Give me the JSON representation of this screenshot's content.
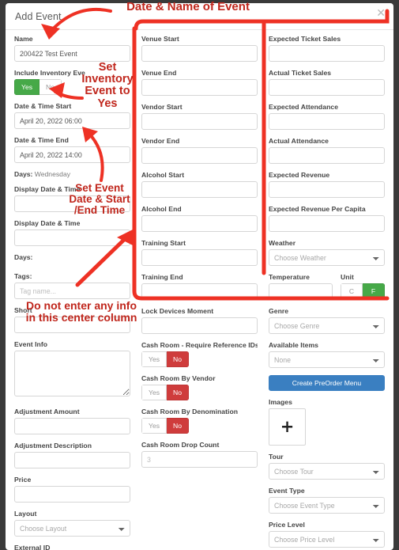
{
  "window": {
    "title": "Add Event",
    "close_icon": "close-icon",
    "close_glyph": "✕"
  },
  "colors": {
    "toggle_on_green": "#46a948",
    "toggle_on_red": "#cf3c3c",
    "primary_button": "#3a7fc1",
    "annotation_red": "#c0261c",
    "label_text": "#444444",
    "input_border": "#d6d6d6"
  },
  "left_column": {
    "name": {
      "label": "Name",
      "value": "200422 Test Event",
      "placeholder": ""
    },
    "include_inventory": {
      "label": "Include Inventory Eve",
      "options": [
        "Yes",
        "No"
      ],
      "selected": "Yes"
    },
    "datetime_start": {
      "label": "Date & Time Start",
      "value": "April 20, 2022 06:00"
    },
    "datetime_end": {
      "label": "Date & Time End",
      "value": "April 20, 2022 14:00"
    },
    "days_1": {
      "label": "Days:",
      "value": "Wednesday"
    },
    "display_datetime_1": {
      "label": "Display Date & Time",
      "value": ""
    },
    "display_datetime_2": {
      "label": "Display Date & Time",
      "value": ""
    },
    "days_2": {
      "label": "Days:",
      "value": ""
    },
    "tags": {
      "label": "Tags:",
      "value": "",
      "placeholder": "Tag name..."
    },
    "short": {
      "label": "Short",
      "value": ""
    },
    "event_info": {
      "label": "Event Info",
      "value": ""
    },
    "adjustment_amount": {
      "label": "Adjustment Amount",
      "value": ""
    },
    "adjustment_description": {
      "label": "Adjustment Description",
      "value": ""
    },
    "price": {
      "label": "Price",
      "value": ""
    },
    "layout": {
      "label": "Layout",
      "selected": "Choose Layout"
    },
    "external_id": {
      "label": "External ID"
    }
  },
  "center_column": {
    "venue_start": {
      "label": "Venue Start",
      "value": ""
    },
    "venue_end": {
      "label": "Venue End",
      "value": ""
    },
    "vendor_start": {
      "label": "Vendor Start",
      "value": ""
    },
    "vendor_end": {
      "label": "Vendor End",
      "value": ""
    },
    "alcohol_start": {
      "label": "Alcohol Start",
      "value": ""
    },
    "alcohol_end": {
      "label": "Alcohol End",
      "value": ""
    },
    "training_start": {
      "label": "Training Start",
      "value": ""
    },
    "training_end": {
      "label": "Training End",
      "value": ""
    },
    "lock_devices_moment": {
      "label": "Lock Devices Moment",
      "value": ""
    },
    "cash_room_reference_ids": {
      "label": "Cash Room - Require Reference IDs",
      "options": [
        "Yes",
        "No"
      ],
      "selected": "No"
    },
    "cash_room_by_vendor": {
      "label": "Cash Room By Vendor",
      "options": [
        "Yes",
        "No"
      ],
      "selected": "No"
    },
    "cash_room_by_denomination": {
      "label": "Cash Room By Denomination",
      "options": [
        "Yes",
        "No"
      ],
      "selected": "No"
    },
    "cash_room_drop_count": {
      "label": "Cash Room Drop Count",
      "value": "3"
    }
  },
  "right_column": {
    "expected_ticket_sales": {
      "label": "Expected Ticket Sales",
      "value": ""
    },
    "actual_ticket_sales": {
      "label": "Actual Ticket Sales",
      "value": ""
    },
    "expected_attendance": {
      "label": "Expected Attendance",
      "value": ""
    },
    "actual_attendance": {
      "label": "Actual Attendance",
      "value": ""
    },
    "expected_revenue": {
      "label": "Expected Revenue",
      "value": ""
    },
    "expected_revenue_per_capita": {
      "label": "Expected Revenue Per Capita",
      "value": ""
    },
    "weather": {
      "label": "Weather",
      "selected": "Choose Weather"
    },
    "temperature": {
      "label": "Temperature",
      "value": ""
    },
    "unit": {
      "label": "Unit",
      "options": [
        "C",
        "F"
      ],
      "selected": "F"
    },
    "genre": {
      "label": "Genre",
      "selected": "Choose Genre"
    },
    "available_items": {
      "label": "Available Items",
      "selected": "None"
    },
    "create_preorder_menu": {
      "label": "Create PreOrder Menu"
    },
    "images": {
      "label": "Images",
      "add_icon": "plus-icon",
      "add_glyph": "+"
    },
    "tour": {
      "label": "Tour",
      "selected": "Choose Tour"
    },
    "event_type": {
      "label": "Event Type",
      "selected": "Choose Event Type"
    },
    "price_level": {
      "label": "Price Level",
      "selected": "Choose Price Level"
    }
  },
  "annotations": {
    "title": "Date & Name of Event",
    "inventory": "Set Inventory Event to Yes",
    "datetime": "Set Event Date & Start /End Time",
    "center_column": "Do not enter any info in this center column"
  }
}
